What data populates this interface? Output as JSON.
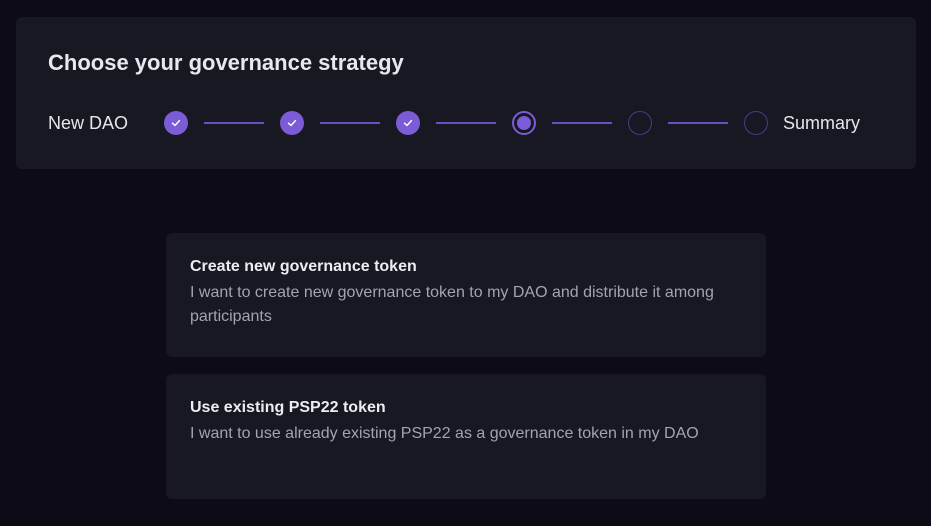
{
  "header": {
    "title": "Choose your governance strategy"
  },
  "stepper": {
    "start_label": "New DAO",
    "end_label": "Summary",
    "steps": [
      {
        "state": "done",
        "icon": "check-icon"
      },
      {
        "state": "done",
        "icon": "check-icon"
      },
      {
        "state": "done",
        "icon": "check-icon"
      },
      {
        "state": "current"
      },
      {
        "state": "todo"
      },
      {
        "state": "todo"
      }
    ],
    "accent_color": "#7b5cd6"
  },
  "options": [
    {
      "title": "Create new governance token",
      "description": "I want to create new governance token to my DAO and distribute it among participants"
    },
    {
      "title": "Use existing PSP22 token",
      "description": "I want to use already existing PSP22 as a governance token in my DAO"
    }
  ]
}
